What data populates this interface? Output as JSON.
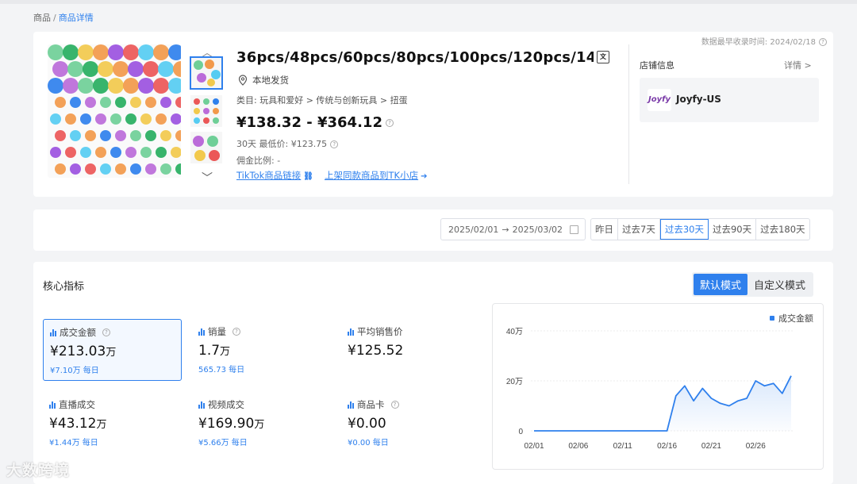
{
  "breadcrumb": {
    "root": "商品",
    "separator": "/",
    "current": "商品详情"
  },
  "product": {
    "title": "36pcs/48pcs/60pcs/80pcs/100pcs/120pcs/14...",
    "shipping": "本地发货",
    "category": "类目: 玩具和爱好 > 传统与创新玩具 > 扭蛋",
    "price": "¥138.32 - ¥364.12",
    "lowest_30d": "30天 最低价: ¥123.75",
    "commission": "佣金比例: -",
    "tiktok_link": "TikTok商品链接",
    "list_link": "上架同款商品到TK小店"
  },
  "update_time": "数据最早收录时间: 2024/02/18",
  "shop": {
    "label": "店铺信息",
    "detail": "详情 >",
    "logo_text": "Joyfy",
    "name": "Joyfy-US"
  },
  "date_range": {
    "start": "2025/02/01",
    "arrow": "→",
    "end": "2025/03/02"
  },
  "periods": [
    "昨日",
    "过去7天",
    "过去30天",
    "过去90天",
    "过去180天"
  ],
  "active_period": "过去30天",
  "metrics_title": "核心指标",
  "modes": [
    "默认模式",
    "自定义模式"
  ],
  "metrics": [
    {
      "label": "成交金额",
      "value": "¥213.03",
      "unit": "万",
      "sub": "¥7.10万 每日",
      "help": true
    },
    {
      "label": "销量",
      "value": "1.7",
      "unit": "万",
      "sub": "565.73 每日",
      "help": true
    },
    {
      "label": "平均销售价",
      "value": "¥125.52",
      "unit": "",
      "sub": "",
      "help": false
    },
    {
      "label": "直播成交",
      "value": "¥43.12",
      "unit": "万",
      "sub": "¥1.44万 每日",
      "help": false
    },
    {
      "label": "视频成交",
      "value": "¥169.90",
      "unit": "万",
      "sub": "¥5.66万 每日",
      "help": false
    },
    {
      "label": "商品卡",
      "value": "¥0.00",
      "unit": "",
      "sub": "¥0.00 每日",
      "help": true
    }
  ],
  "chart_data": {
    "type": "area",
    "series": [
      {
        "name": "成交金额",
        "values": [
          0,
          0,
          0,
          0,
          0,
          0,
          0,
          0,
          0,
          0,
          0,
          0,
          0,
          0,
          0,
          0,
          14,
          18,
          12,
          17,
          13,
          11,
          10,
          12,
          13,
          20,
          18,
          19,
          15,
          22
        ]
      }
    ],
    "x_ticks": [
      "02/01",
      "02/06",
      "02/11",
      "02/16",
      "02/21",
      "02/26"
    ],
    "y_ticks": [
      "0",
      "20万",
      "40万"
    ],
    "ylim": [
      0,
      40
    ],
    "legend": "top-right",
    "color": "#2f80ed"
  },
  "watermark": "大数跨境"
}
